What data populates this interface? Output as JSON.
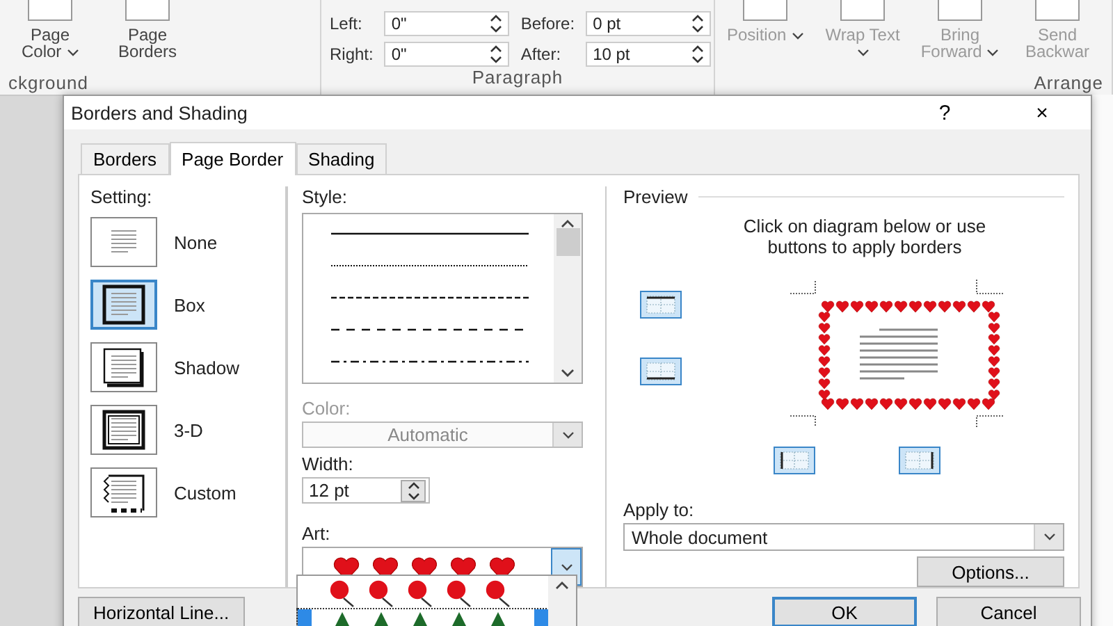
{
  "ribbon": {
    "groups": [
      {
        "kind": "buttons",
        "label": "ckground",
        "buttons": [
          {
            "label": "Page Color",
            "caret": true,
            "disabled": false
          },
          {
            "label": "Page Borders",
            "caret": false,
            "disabled": false
          }
        ]
      },
      {
        "kind": "paragraph",
        "label": "Paragraph",
        "fields": [
          {
            "label": "Left:",
            "value": "0\""
          },
          {
            "label": "Right:",
            "value": "0\""
          },
          {
            "label": "Before:",
            "value": "0 pt"
          },
          {
            "label": "After:",
            "value": "10 pt"
          }
        ]
      },
      {
        "kind": "buttons",
        "label": "Arrange",
        "buttons": [
          {
            "label": "Position",
            "caret": true,
            "disabled": true
          },
          {
            "label": "Wrap Text",
            "caret": true,
            "disabled": true
          },
          {
            "label": "Bring Forward",
            "caret": true,
            "disabled": true
          },
          {
            "label": "Send Backwar",
            "caret": false,
            "disabled": true
          }
        ]
      }
    ]
  },
  "dialog": {
    "title": "Borders and Shading",
    "title_buttons": [
      "?",
      "×"
    ],
    "tabs": [
      {
        "label": "Borders",
        "selected": false
      },
      {
        "label": "Page Border",
        "selected": true
      },
      {
        "label": "Shading",
        "selected": false
      }
    ],
    "setting": {
      "label": "Setting:",
      "items": [
        {
          "label": "None",
          "kind": "none",
          "selected": false
        },
        {
          "label": "Box",
          "kind": "box",
          "selected": true
        },
        {
          "label": "Shadow",
          "kind": "shadow",
          "selected": false
        },
        {
          "label": "3-D",
          "kind": "threed",
          "selected": false
        },
        {
          "label": "Custom",
          "kind": "custom",
          "selected": false
        }
      ]
    },
    "style": {
      "label": "Style:",
      "lines": [
        {
          "kind": "solid"
        },
        {
          "kind": "dotted"
        },
        {
          "kind": "dashed"
        },
        {
          "kind": "dash"
        },
        {
          "kind": "dash-dot"
        }
      ]
    },
    "color": {
      "label": "Color:",
      "value": "Automatic",
      "disabled": true
    },
    "width": {
      "label": "Width:",
      "value": "12 pt"
    },
    "art": {
      "label": "Art:",
      "kind": "heart",
      "options": [
        {
          "kind": "balloon",
          "selected": false
        },
        {
          "kind": "tree",
          "selected": true
        }
      ]
    },
    "preview": {
      "label": "Preview",
      "hint": "Click on diagram below or use buttons to apply borders",
      "edge_buttons": [
        {
          "kind": "top"
        },
        {
          "kind": "bottom"
        },
        {
          "kind": "left"
        },
        {
          "kind": "right"
        }
      ]
    },
    "apply_to": {
      "label": "Apply to:",
      "value": "Whole document"
    },
    "options_button": "Options...",
    "horizontal_line_button": "Horizontal Line...",
    "ok_button": "OK",
    "cancel_button": "Cancel"
  }
}
